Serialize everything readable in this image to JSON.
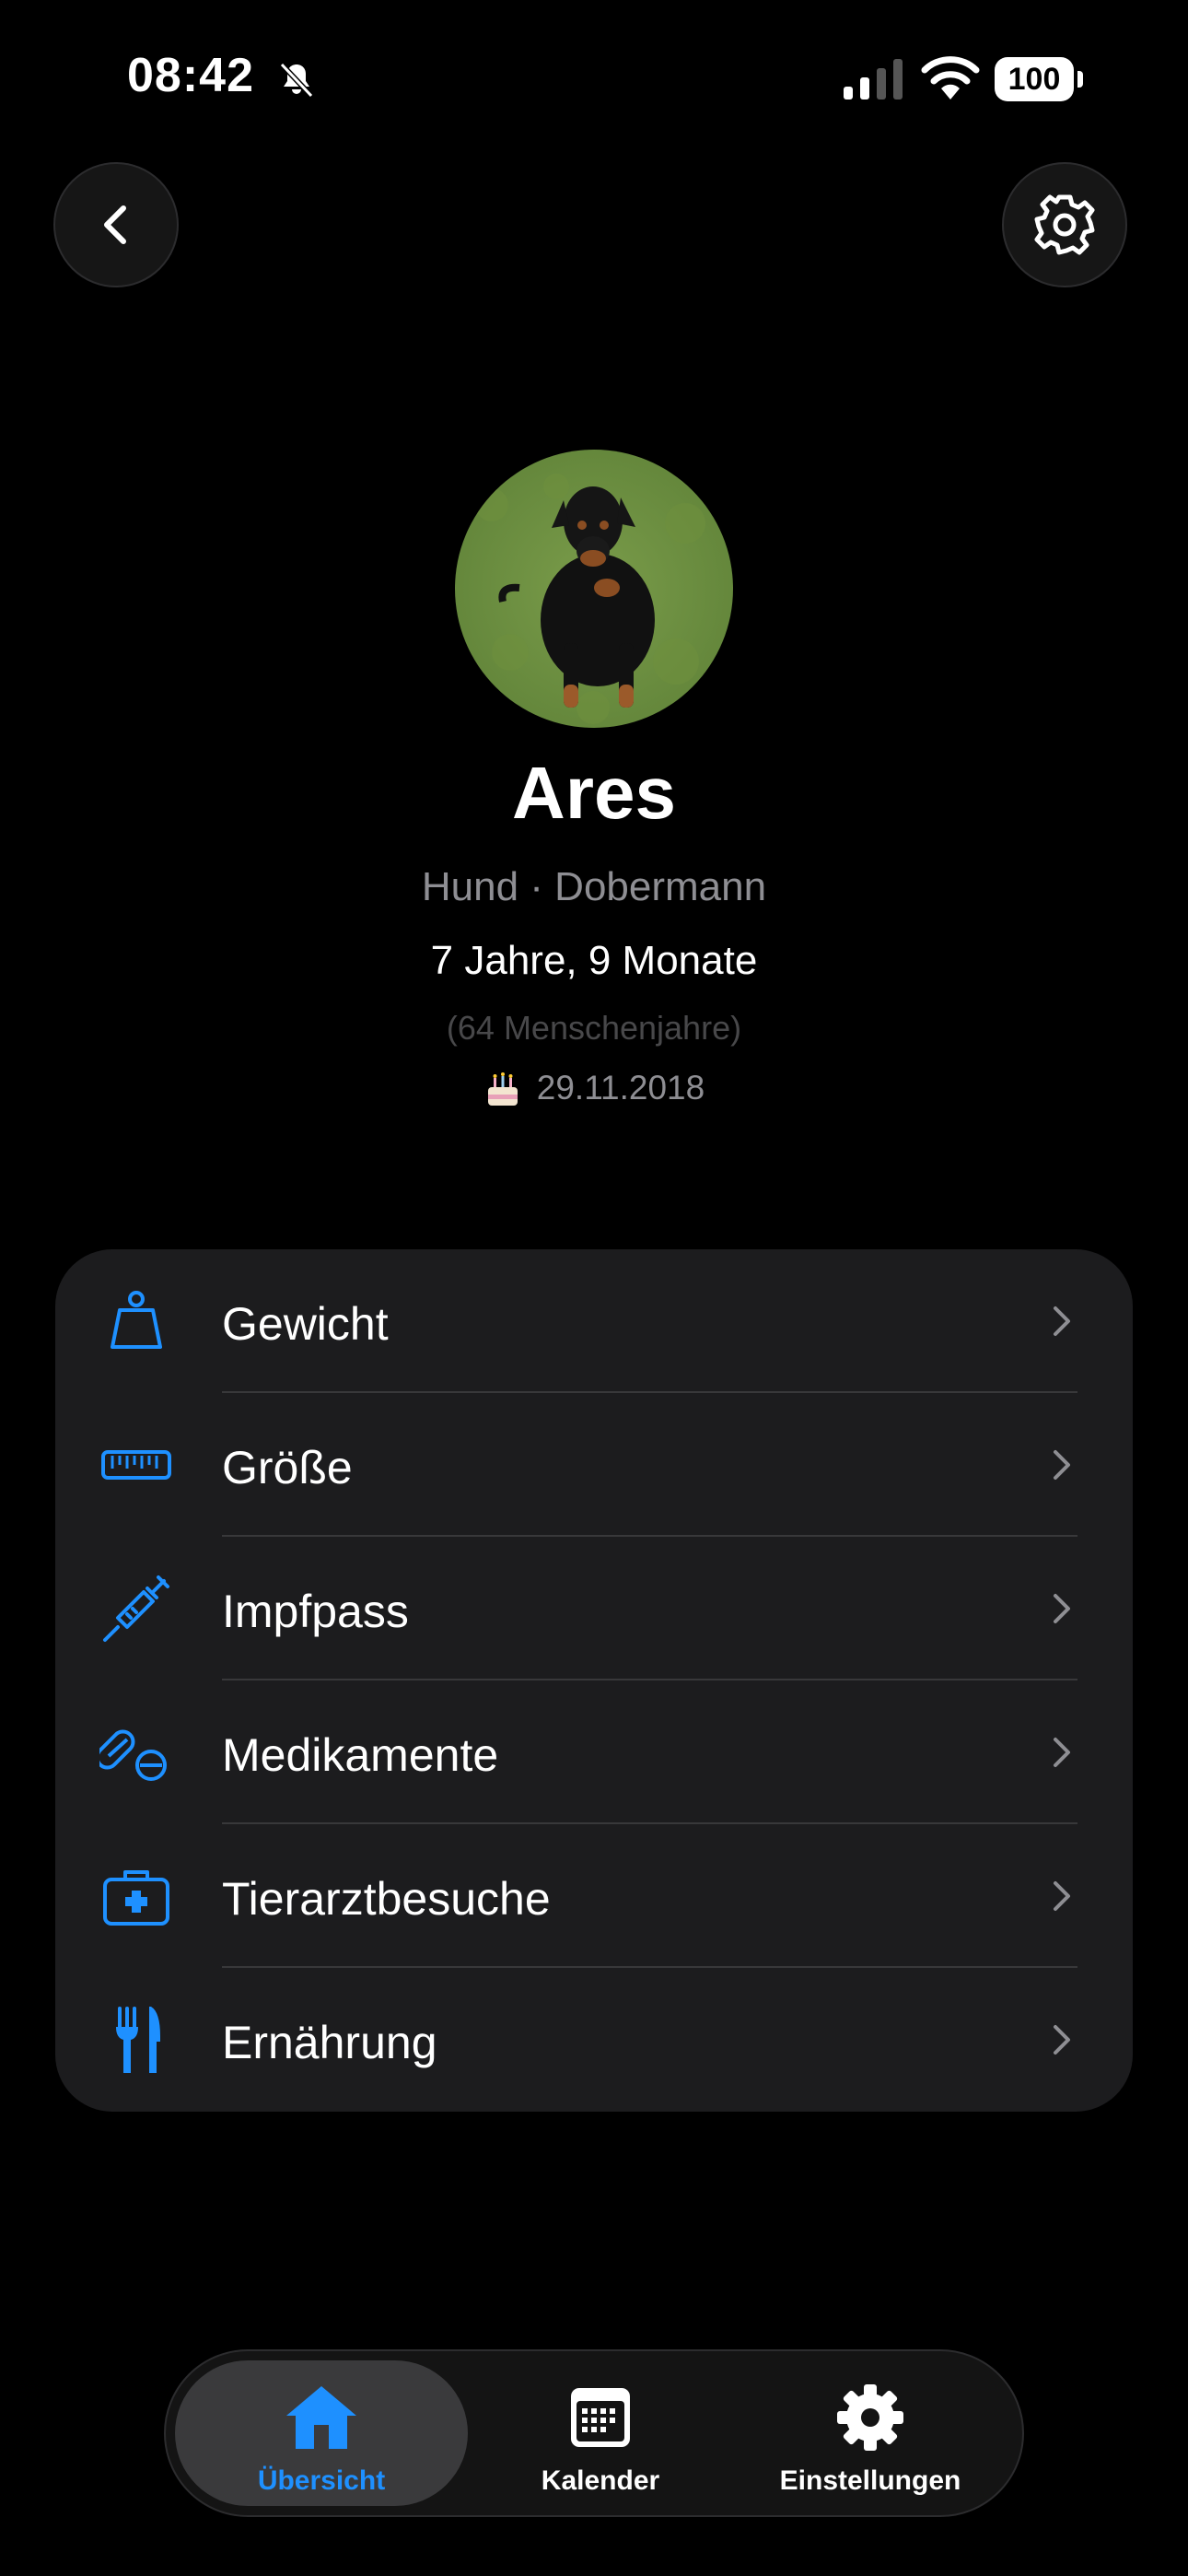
{
  "status_bar": {
    "time": "08:42",
    "battery": "100"
  },
  "profile": {
    "name": "Ares",
    "species_breed": "Hund · Dobermann",
    "age": "7 Jahre, 9 Monate",
    "human_years": "(64 Menschenjahre)",
    "birthday": "29.11.2018"
  },
  "menu": {
    "items": [
      {
        "label": "Gewicht",
        "icon": "weight-icon"
      },
      {
        "label": "Größe",
        "icon": "ruler-icon"
      },
      {
        "label": "Impfpass",
        "icon": "syringe-icon"
      },
      {
        "label": "Medikamente",
        "icon": "pills-icon"
      },
      {
        "label": "Tierarztbesuche",
        "icon": "medical-kit-icon"
      },
      {
        "label": "Ernährung",
        "icon": "fork-knife-icon"
      }
    ]
  },
  "tabbar": {
    "tabs": [
      {
        "label": "Übersicht",
        "icon": "house-icon",
        "active": true
      },
      {
        "label": "Kalender",
        "icon": "calendar-icon",
        "active": false
      },
      {
        "label": "Einstellungen",
        "icon": "gear-icon",
        "active": false
      }
    ]
  },
  "colors": {
    "accent": "#1e90ff",
    "background": "#000000",
    "card": "#1c1c1e",
    "secondary_text": "#8e8e93"
  }
}
